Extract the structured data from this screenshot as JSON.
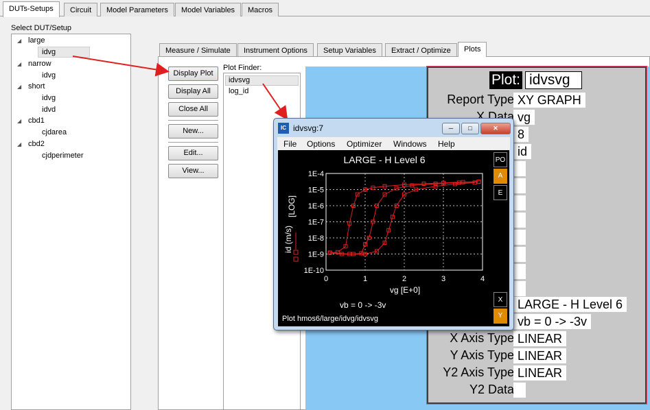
{
  "top_tabs": [
    "DUTs-Setups",
    "Circuit",
    "Model Parameters",
    "Model Variables",
    "Macros"
  ],
  "select_label": "Select DUT/Setup",
  "tree": [
    {
      "label": "large",
      "children": [
        "idvg"
      ]
    },
    {
      "label": "narrow",
      "children": [
        "idvg"
      ]
    },
    {
      "label": "short",
      "children": [
        "idvg",
        "idvd"
      ]
    },
    {
      "label": "cbd1",
      "children": [
        "cjdarea"
      ]
    },
    {
      "label": "cbd2",
      "children": [
        "cjdperimeter"
      ]
    }
  ],
  "inner_tabs": [
    "Measure / Simulate",
    "Instrument Options",
    "Setup Variables",
    "Extract / Optimize",
    "Plots"
  ],
  "buttons": {
    "display_plot": "Display Plot",
    "display_all": "Display All",
    "close_all": "Close All",
    "new": "New...",
    "edit": "Edit...",
    "view": "View..."
  },
  "plot_finder": {
    "label": "Plot Finder:",
    "items": [
      "idvsvg",
      "log_id"
    ]
  },
  "form": {
    "plot_label": "Plot:",
    "plot_value": "idvsvg",
    "report_type_label": "Report Type:",
    "report_type_value": "XY GRAPH",
    "x_data_label": "X Data:",
    "x_data_value": "vg",
    "num_value": "8",
    "id_value": "id",
    "title_value": "LARGE - H Level 6",
    "subtitle_value": "vb = 0 -> -3v",
    "x_axis_type_label": "X Axis Type:",
    "x_axis_type_value": "LINEAR",
    "y_axis_type_label": "Y Axis Type:",
    "y_axis_type_value": "LINEAR",
    "y2_axis_type_label": "Y2 Axis Type:",
    "y2_axis_type_value": "LINEAR",
    "y2_data_label": "Y2 Data:"
  },
  "window": {
    "title": "idvsvg:7",
    "menu": [
      "File",
      "Options",
      "Optimizer",
      "Windows",
      "Help"
    ],
    "side_buttons_top": [
      "PO",
      "A",
      "E"
    ],
    "side_buttons_bottom": [
      "X",
      "Y"
    ],
    "status": "Plot hmos6/large/idvg/idvsvg",
    "caption": "vb = 0 -> -3v"
  },
  "colors": {
    "accent_orange": "#e08a00",
    "plot_red": "#e02020",
    "arrow_red": "#e02020"
  },
  "chart_data": {
    "type": "line",
    "title": "LARGE - H Level 6",
    "xlabel": "vg  [E+0]",
    "ylabel": "id (m/s)",
    "ylabel_scale": "[LOG]",
    "xlim": [
      0,
      4
    ],
    "ylim_log": [
      -10,
      -4
    ],
    "x_ticks": [
      "0",
      "1",
      "2",
      "3",
      "4"
    ],
    "y_ticks": [
      "1E-10",
      "1E-9",
      "1E-8",
      "1E-7",
      "1E-6",
      "1E-5",
      "1E-4"
    ],
    "grid": true,
    "series": [
      {
        "x": [
          0.1,
          0.3,
          0.5,
          0.6,
          0.7,
          0.8,
          1.0,
          1.2,
          1.5,
          2.0,
          2.5,
          3.0,
          3.5,
          3.9
        ],
        "y": [
          1.2e-09,
          1.3e-09,
          3e-09,
          8e-08,
          1e-06,
          5e-06,
          1e-05,
          1.3e-05,
          1.6e-05,
          2e-05,
          2.3e-05,
          2.6e-05,
          2.9e-05,
          3.1e-05
        ]
      },
      {
        "x": [
          0.1,
          0.4,
          0.7,
          0.9,
          1.0,
          1.1,
          1.2,
          1.3,
          1.5,
          1.8,
          2.2,
          2.8,
          3.4,
          3.9
        ],
        "y": [
          1.2e-09,
          1e-09,
          1e-09,
          1.1e-09,
          4e-09,
          1e-08,
          1e-07,
          1e-06,
          5e-06,
          1.2e-05,
          1.8e-05,
          2.3e-05,
          2.7e-05,
          3e-05
        ]
      },
      {
        "x": [
          0.1,
          0.6,
          1.0,
          1.3,
          1.5,
          1.6,
          1.7,
          1.8,
          2.0,
          2.3,
          2.8,
          3.3,
          3.8
        ],
        "y": [
          1.2e-09,
          1e-09,
          1e-09,
          1.5e-09,
          5e-09,
          3e-08,
          2e-07,
          1e-06,
          5e-06,
          1e-05,
          1.6e-05,
          2.2e-05,
          2.7e-05
        ]
      }
    ]
  }
}
